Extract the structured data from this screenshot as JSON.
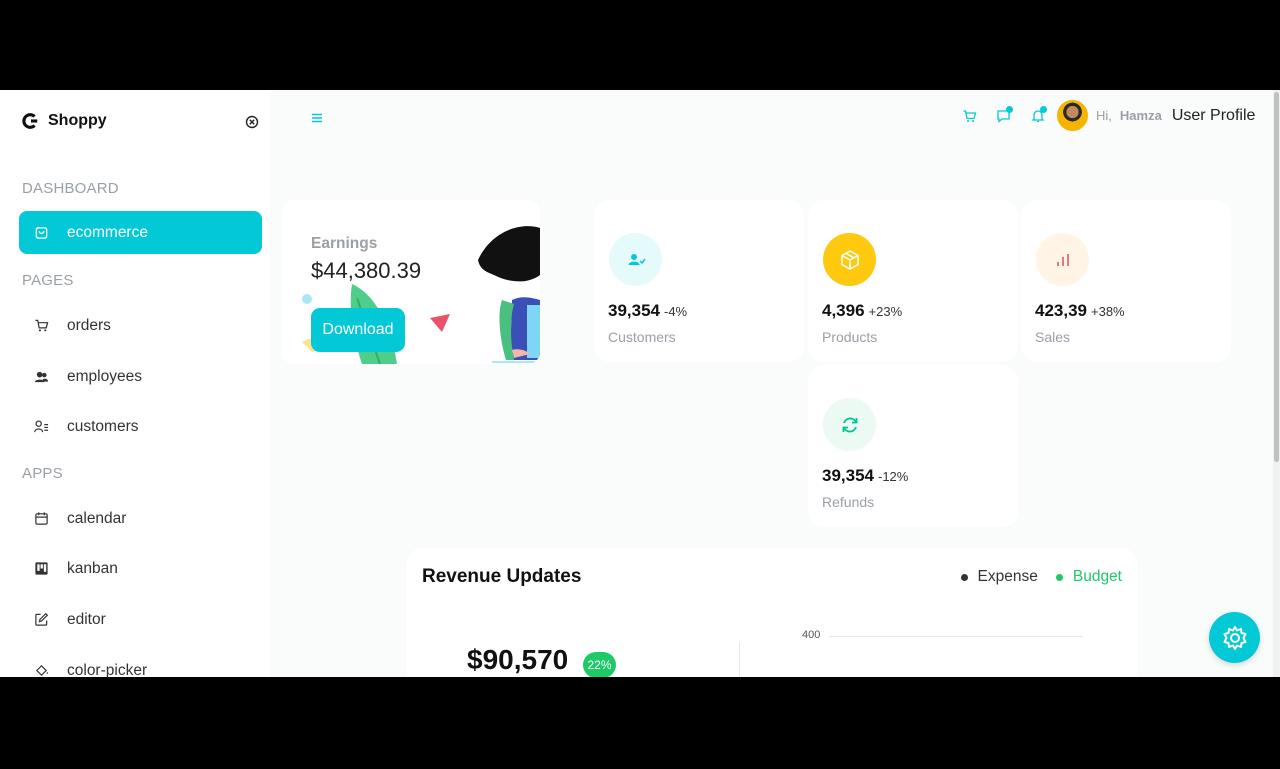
{
  "app": {
    "brand": "Shoppy"
  },
  "sidebar": {
    "sections": [
      {
        "title": "DASHBOARD"
      },
      {
        "title": "PAGES"
      },
      {
        "title": "APPS"
      }
    ],
    "items": [
      {
        "label": "ecommerce",
        "icon": "shopping-bag-icon",
        "active": true
      },
      {
        "label": "orders",
        "icon": "cart-icon"
      },
      {
        "label": "employees",
        "icon": "people-icon"
      },
      {
        "label": "customers",
        "icon": "person-list-icon"
      },
      {
        "label": "calendar",
        "icon": "calendar-icon"
      },
      {
        "label": "kanban",
        "icon": "kanban-icon"
      },
      {
        "label": "editor",
        "icon": "edit-icon"
      },
      {
        "label": "color-picker",
        "icon": "paint-bucket-icon"
      }
    ]
  },
  "header": {
    "greeting": "Hi,",
    "user_name": "Hamza",
    "profile_label": "User Profile"
  },
  "earnings": {
    "label": "Earnings",
    "value": "$44,380.39",
    "button": "Download"
  },
  "stats": [
    {
      "value": "39,354",
      "pct": "-4%",
      "label": "Customers",
      "icon": "customers-icon",
      "icon_color": "#03c9d7",
      "icon_bg": "#e5fafb"
    },
    {
      "value": "4,396",
      "pct": "+23%",
      "label": "Products",
      "icon": "box-icon",
      "icon_color": "#ffffff",
      "icon_bg": "#fec90f"
    },
    {
      "value": "423,39",
      "pct": "+38%",
      "label": "Sales",
      "icon": "bar-chart-icon",
      "icon_color": "#e46a76",
      "icon_bg": "#fff4e5"
    },
    {
      "value": "39,354",
      "pct": "-12%",
      "label": "Refunds",
      "icon": "refresh-icon",
      "icon_color": "#00c292",
      "icon_bg": "#ebfaf2"
    }
  ],
  "revenue": {
    "title": "Revenue Updates",
    "legend": [
      {
        "label": "Expense",
        "color": "#333333"
      },
      {
        "label": "Budget",
        "color": "#1ec968"
      }
    ],
    "amount": "$90,570",
    "badge": "22%",
    "axis_tick": "400"
  },
  "colors": {
    "accent": "#03c9d7"
  }
}
